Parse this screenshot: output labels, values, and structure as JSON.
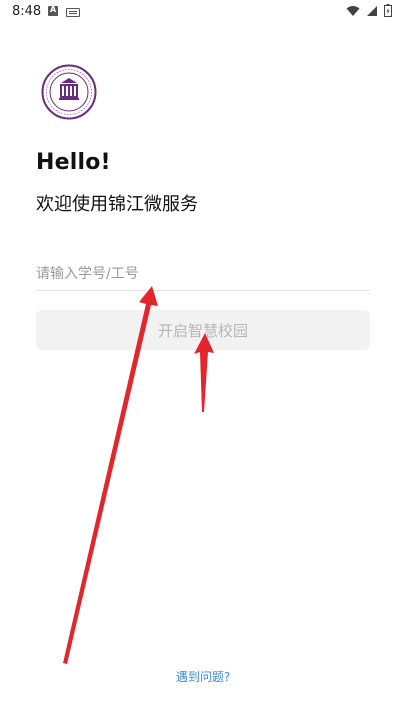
{
  "status_bar": {
    "time": "8:48"
  },
  "login": {
    "title": "Hello!",
    "subtitle": "欢迎使用锦江微服务",
    "id_placeholder": "请输入学号/工号",
    "id_value": "",
    "start_button_label": "开启智慧校园",
    "help_link": "遇到问题?"
  },
  "colors": {
    "button_bg": "#f2f2f2",
    "button_text": "#b6b6b6",
    "link": "#3b8fd7",
    "logo_purple": "#6c2a7e",
    "annotation_red": "#e3262b"
  },
  "icons": [
    "school-logo-icon",
    "wifi-icon",
    "signal-icon",
    "battery-icon"
  ]
}
